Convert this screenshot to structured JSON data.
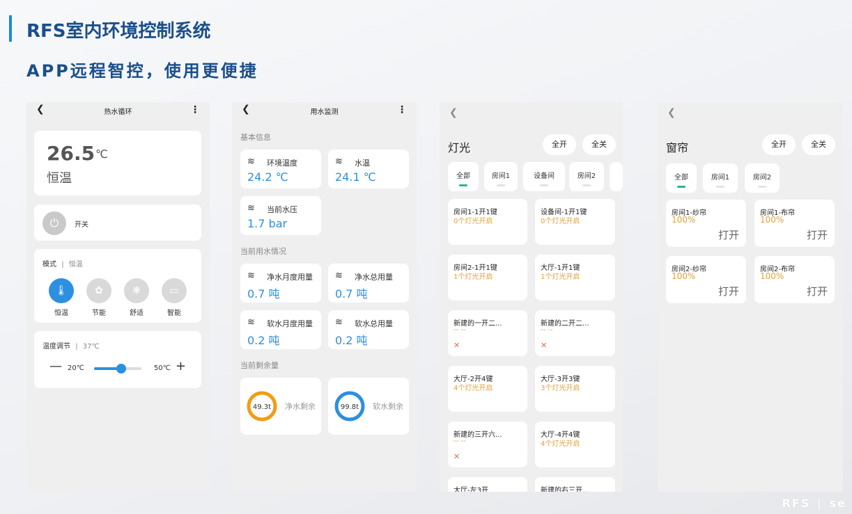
{
  "header": {
    "title": "RFS室内环境控制系统",
    "subtitle": "APP远程智控，使用更便捷"
  },
  "footer": {
    "brand": "RFS",
    "sep": "|",
    "tail": "se"
  },
  "phone1": {
    "title": "热水循环",
    "temp_value": "26.5",
    "temp_unit": "℃",
    "temp_mode": "恒温",
    "power_label": "开关",
    "mode_header": "模式",
    "mode_sep": "|",
    "mode_current": "恒温",
    "modes": [
      {
        "label": "恒温",
        "active": true,
        "icon": "thermometer-icon"
      },
      {
        "label": "节能",
        "active": false,
        "icon": "leaf-icon"
      },
      {
        "label": "舒适",
        "active": false,
        "icon": "fan-icon"
      },
      {
        "label": "智能",
        "active": false,
        "icon": "smart-icon"
      }
    ],
    "adjust_header": "温度调节",
    "adjust_sep": "|",
    "adjust_current": "37℃",
    "min_label": "20℃",
    "max_label": "50℃",
    "slider_fraction": 0.57
  },
  "phone2": {
    "title": "用水监测",
    "sec_basic": "基本信息",
    "env_temp": {
      "name": "环境温度",
      "value": "24.2 ℃"
    },
    "water_temp": {
      "name": "水温",
      "value": "24.1 ℃"
    },
    "water_pressure": {
      "name": "当前水压",
      "value": "1.7 bar"
    },
    "sec_usage": "当前用水情况",
    "pure_month": {
      "name": "净水月度用量",
      "value": "0.7 吨"
    },
    "pure_total": {
      "name": "净水总用量",
      "value": "0.7 吨"
    },
    "soft_month": {
      "name": "软水月度用量",
      "value": "0.2 吨"
    },
    "soft_total": {
      "name": "软水总用量",
      "value": "0.2 吨"
    },
    "sec_remain": "当前剩余量",
    "pure_remain": {
      "value": "49.3t",
      "label": "净水剩余",
      "color": "#f39c12"
    },
    "soft_remain": {
      "value": "99.8t",
      "label": "软水剩余",
      "color": "#2d8fe0"
    }
  },
  "phone3": {
    "title": "灯光",
    "all_on": "全开",
    "all_off": "全关",
    "tabs": [
      "全部",
      "房间1",
      "设备间",
      "房间2"
    ],
    "devices": [
      {
        "name": "房间1-1开1键",
        "status": "0个灯光开启"
      },
      {
        "name": "设备间-1开1键",
        "status": "0个灯光开启"
      },
      {
        "name": "房间2-1开1键",
        "status": "1个灯光开启"
      },
      {
        "name": "大厅-1开1键",
        "status": "1个灯光开启"
      },
      {
        "name": "新建的一开二...",
        "status": "-- --"
      },
      {
        "name": "新建的二开二...",
        "status": "-- --"
      },
      {
        "name": "大厅-2开4键",
        "status": "4个灯光开启"
      },
      {
        "name": "大厅-3开3键",
        "status": "3个灯光开启"
      },
      {
        "name": "新建的三开六...",
        "status": "-- --"
      },
      {
        "name": "大厅-4开4键",
        "status": "4个灯光开启"
      },
      {
        "name": "大厅-左3开",
        "status": ""
      },
      {
        "name": "新建的右三开...",
        "status": ""
      }
    ]
  },
  "phone4": {
    "title": "窗帘",
    "all_on": "全开",
    "all_off": "全关",
    "tabs": [
      "全部",
      "房间1",
      "房间2"
    ],
    "curtains": [
      {
        "name": "房间1-纱帘",
        "pct": "100%",
        "action": "打开"
      },
      {
        "name": "房间1-布帘",
        "pct": "100%",
        "action": "打开"
      },
      {
        "name": "房间2-纱帘",
        "pct": "100%",
        "action": "打开"
      },
      {
        "name": "房间2-布帘",
        "pct": "100%",
        "action": "打开"
      }
    ]
  }
}
